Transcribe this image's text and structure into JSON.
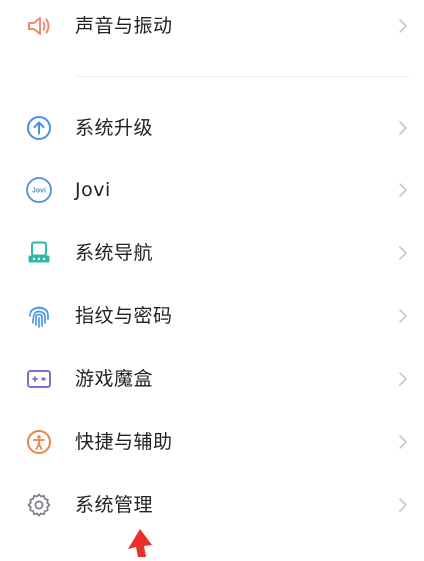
{
  "colors": {
    "sound": "#f08a6e",
    "upgrade": "#4a90e2",
    "jovi": "#4a8fe0",
    "navigation": "#2eb8a8",
    "fingerprint": "#4a9be8",
    "game": "#7b6fd6",
    "shortcut": "#e8844a",
    "system": "#7a7f8a",
    "chevron": "#c8c8c8",
    "arrow": "#e8302a"
  },
  "top_items": [
    {
      "label": "声音与振动",
      "icon": "speaker-icon"
    }
  ],
  "items": [
    {
      "label": "系统升级",
      "icon": "upgrade-arrow-icon"
    },
    {
      "label": "Jovi",
      "icon": "jovi-icon",
      "icon_text": "Jovi"
    },
    {
      "label": "系统导航",
      "icon": "navigation-icon"
    },
    {
      "label": "指纹与密码",
      "icon": "fingerprint-icon"
    },
    {
      "label": "游戏魔盒",
      "icon": "game-box-icon"
    },
    {
      "label": "快捷与辅助",
      "icon": "accessibility-icon"
    },
    {
      "label": "系统管理",
      "icon": "gear-icon"
    }
  ]
}
